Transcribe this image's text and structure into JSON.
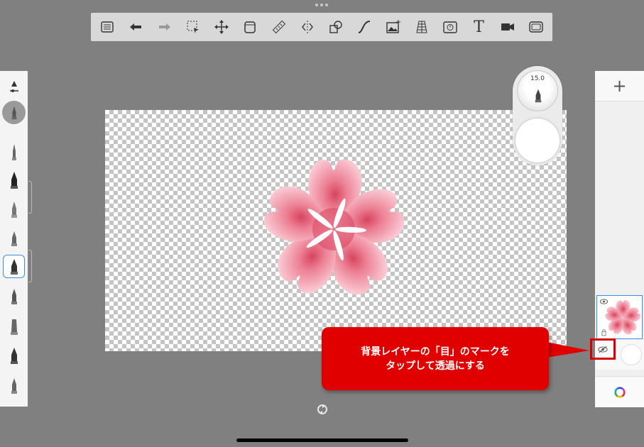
{
  "toolbar": {
    "buttons": [
      "list-icon",
      "undo-icon",
      "redo-icon",
      "select-icon",
      "transform-icon",
      "layer-stack-icon",
      "ruler-icon",
      "symmetry-icon",
      "shapes-icon",
      "curve-icon",
      "image-icon",
      "perspective-icon",
      "time-lapse-icon",
      "text-icon",
      "video-icon",
      "fullscreen-icon"
    ],
    "text_glyph": "T"
  },
  "puck": {
    "size_value": "15.0"
  },
  "layers": {
    "add_label": "+"
  },
  "callout": {
    "line1": "背景レイヤーの「目」のマークを",
    "line2": "タップして透過にする"
  },
  "colors": {
    "accent": "#3a8ee6",
    "callout": "#e00000",
    "petal": "#f4a7b9"
  }
}
